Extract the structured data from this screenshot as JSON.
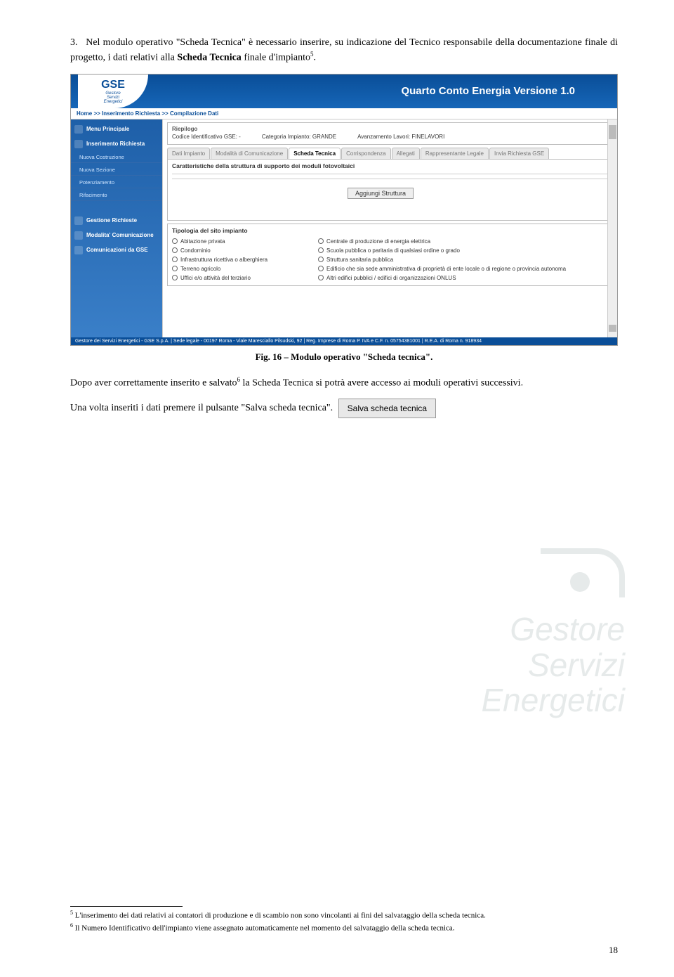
{
  "intro": {
    "num": "3.",
    "text_a": "Nel modulo operativo \"Scheda Tecnica\" è necessario inserire, su indicazione del Tecnico responsabile della documentazione finale di progetto, i dati relativi alla ",
    "text_b": "Scheda Tecnica",
    "text_c": " finale d'impianto",
    "sup": "5",
    "text_d": "."
  },
  "screenshot": {
    "banner_title": "Quarto Conto Energia Versione 1.0",
    "logo": "GSE",
    "logo_sub1": "Gestore",
    "logo_sub2": "Servizi",
    "logo_sub3": "Energetici",
    "breadcrumb": "Home >> Inserimento Richiesta >> Compilazione Dati",
    "side_items": [
      "Menu Principale",
      "Inserimento Richiesta"
    ],
    "side_subs": [
      "Nuova Costruzione",
      "Nuova Sezione",
      "Potenziamento",
      "Rifacimento"
    ],
    "side_items2": [
      "Gestione Richieste",
      "Modalita' Comunicazione",
      "Comunicazioni da GSE"
    ],
    "riepilogo_title": "Riepilogo",
    "riepilogo_row": {
      "a": "Codice Identificativo GSE: -",
      "b": "Categoria Impianto: GRANDE",
      "c": "Avanzamento Lavori: FINELAVORI"
    },
    "tabs": [
      "Dati Impianto",
      "Modalità di Comunicazione",
      "Scheda Tecnica",
      "Corrispondenza",
      "Allegati",
      "Rappresentante Legale",
      "Invia Richiesta GSE"
    ],
    "active_tab": 2,
    "panel_hd": "Caratteristiche della struttura di supporto dei moduli fotovoltaici",
    "btn_aggiungi": "Aggiungi Struttura",
    "panel2_hd": "Tipologia del sito impianto",
    "radios_left": [
      "Abitazione privata",
      "Condominio",
      "Infrastruttura ricettiva o alberghiera",
      "Terreno agricolo",
      "Uffici e/o attività del terziario"
    ],
    "radios_right": [
      "Centrale di produzione di energia elettrica",
      "Scuola pubblica o paritaria di qualsiasi ordine o grado",
      "Struttura sanitaria pubblica",
      "Edificio che sia sede amministrativa di proprietà di ente locale o di regione o provincia autonoma",
      "Altri edifici pubblici / edifici di organizzazioni ONLUS"
    ],
    "footer": "Gestore dei Servizi Energetici - GSE S.p.A. | Sede legale - 00197 Roma - Viale Maresciallo Pilsudski, 92 | Reg. Imprese di Roma P. IVA e C.F. n. 05754381001 | R.E.A. di Roma n. 918934"
  },
  "caption": "Fig. 16 – Modulo operativo \"Scheda tecnica\".",
  "para1_a": "Dopo aver correttamente inserito e salvato",
  "para1_sup": "6",
  "para1_b": " la Scheda Tecnica si potrà avere accesso ai moduli operativi successivi.",
  "para2": "Una volta inseriti i dati premere il pulsante \"Salva scheda tecnica\".",
  "save_btn": "Salva scheda tecnica",
  "watermark": {
    "l1": "Gestore",
    "l2": "Servizi",
    "l3": "Energetici"
  },
  "fn5_sup": "5",
  "fn5": " L'inserimento dei dati relativi ai contatori di produzione e di scambio non sono vincolanti ai fini del salvataggio della scheda tecnica.",
  "fn6_sup": "6",
  "fn6": " Il Numero Identificativo dell'impianto viene assegnato automaticamente nel momento del salvataggio della scheda tecnica.",
  "page": "18"
}
